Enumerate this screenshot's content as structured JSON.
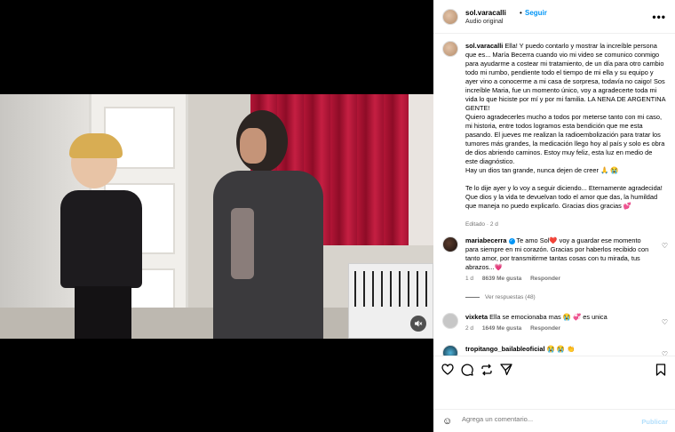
{
  "video": {
    "mute_icon": "speaker-muted-icon"
  },
  "header": {
    "username": "sol.varacalli",
    "separator": "•",
    "follow_label": "Seguir",
    "audio_label": "Audio original",
    "more_icon": "•••"
  },
  "caption": {
    "username": "sol.varacalli",
    "text": " Ella! Y puedo contarlo y mostrar la increíble persona que es... María Becerra cuando vio mi video se comunico conmigo para ayudarme a costear mi tratamiento, de un día para otro cambio todo mi rumbo, pendiente todo el tiempo de mi ella y su equipo y ayer vino a conocerme a mi casa de sorpresa, todavía no caigo! Sos increíble Maria, fue un momento único, voy a agradecerte toda mi vida lo que hiciste por mí y por mi familia. LA NENA DE ARGENTINA GENTE!\nQuiero agradecerles mucho a todos por meterse tanto con mi caso, mi historia, entre todos logramos esta bendición que me esta pasando. El jueves me realizan la radioembolización para tratar los tumores más grandes, la medicación llego hoy al país y solo es obra de dios abriendo caminos. Estoy muy feliz, esta luz en medio de este diagnóstico.\nHay un dios tan grande, nunca dejen de creer 🙏 😭\n\nTe lo dije ayer y lo voy a seguir diciendo... Eternamente agradecida! Que dios y la vida te devuelvan todo el amor que das, la humildad que maneja no puedo explicarlo. Gracias dios gracias 💕",
    "edited": "Editado · 2 d"
  },
  "comments": [
    {
      "username": "mariabecerra",
      "verified": true,
      "text": " Te amo Sol❤️ voy a guardar ese momento para siempre en mi corazón. Gracias por haberlos recibido con tanto amor, por transmitirme tantas cosas con tu mirada, tus abrazos...💗",
      "time": "1 d",
      "likes": "8639 Me gusta",
      "reply": "Responder",
      "view_replies": "Ver respuestas (48)"
    },
    {
      "username": "vixketa",
      "verified": false,
      "text": " Ella se emocionaba mas 😭 💞 es unica",
      "time": "2 d",
      "likes": "1649 Me gusta",
      "reply": "Responder"
    },
    {
      "username": "tropitango_bailableoficial",
      "verified": false,
      "text": " 😭 😭 👏"
    }
  ],
  "actions": {
    "like_icon": "heart-icon",
    "comment_icon": "comment-icon",
    "share_icon": "repost-icon",
    "send_icon": "send-icon",
    "save_icon": "bookmark-icon"
  },
  "add_comment": {
    "placeholder": "Agrega un comentario...",
    "post_label": "Publicar"
  }
}
